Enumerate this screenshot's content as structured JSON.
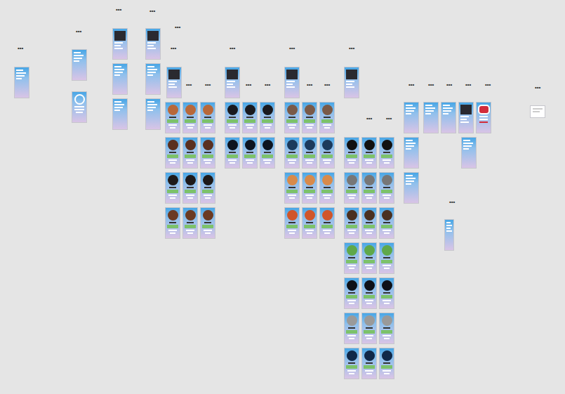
{
  "canvas": {
    "labels": [
      "•••",
      "•••",
      "•••",
      "•••",
      "•••",
      "•••",
      "•••",
      "•••",
      "•••",
      "•••",
      "•••",
      "•••",
      "•••",
      "•••",
      "•••",
      "•••",
      "•••",
      "•••",
      "•••",
      "•••",
      "•••",
      "•••",
      "•••",
      "•••"
    ],
    "groups": [
      {
        "frames": [
          {
            "kind": "plain"
          }
        ]
      },
      {
        "frames": [
          {
            "kind": "plain"
          },
          {
            "kind": "profile"
          }
        ]
      },
      {
        "frames": [
          {
            "kind": "photo"
          },
          {
            "kind": "plain"
          },
          {
            "kind": "plain"
          }
        ]
      },
      {
        "frames": [
          {
            "kind": "photo"
          },
          {
            "kind": "plain"
          },
          {
            "kind": "plain"
          }
        ]
      },
      {
        "frames": [
          {
            "kind": "photo"
          }
        ]
      },
      {
        "frames": [
          {
            "kind": "avatar",
            "color": "#b8683a"
          },
          {
            "kind": "avatar",
            "color": "#b8683a"
          },
          {
            "kind": "avatar",
            "color": "#b8683a"
          },
          {
            "kind": "avatar",
            "color": "#5a3020"
          },
          {
            "kind": "avatar",
            "color": "#5a3020"
          },
          {
            "kind": "avatar",
            "color": "#5a3020"
          },
          {
            "kind": "avatar",
            "color": "#1e1a1a"
          },
          {
            "kind": "avatar",
            "color": "#1e1a1a"
          },
          {
            "kind": "avatar",
            "color": "#1e1a1a"
          },
          {
            "kind": "avatar",
            "color": "#6b3a22"
          },
          {
            "kind": "avatar",
            "color": "#6b3a22"
          },
          {
            "kind": "avatar",
            "color": "#6b3a22"
          }
        ]
      },
      {
        "frames": [
          {
            "kind": "photo"
          }
        ]
      },
      {
        "frames": [
          {
            "kind": "avatar",
            "color": "#1a1a1f"
          },
          {
            "kind": "avatar",
            "color": "#1a1a1f"
          },
          {
            "kind": "avatar",
            "color": "#1a1a1f"
          },
          {
            "kind": "avatar",
            "color": "#0d1420"
          },
          {
            "kind": "avatar",
            "color": "#0d1420"
          },
          {
            "kind": "avatar",
            "color": "#0d1420"
          }
        ]
      },
      {
        "frames": [
          {
            "kind": "photo"
          }
        ]
      },
      {
        "frames": [
          {
            "kind": "avatar",
            "color": "#7a5a48"
          },
          {
            "kind": "avatar",
            "color": "#7a5a48"
          },
          {
            "kind": "avatar",
            "color": "#7a5a48"
          },
          {
            "kind": "avatar",
            "color": "#1c3a5c"
          },
          {
            "kind": "avatar",
            "color": "#1c3a5c"
          },
          {
            "kind": "avatar",
            "color": "#1c3a5c"
          },
          {
            "kind": "avatar",
            "color": "#d88a4a"
          },
          {
            "kind": "avatar",
            "color": "#d88a4a"
          },
          {
            "kind": "avatar",
            "color": "#d88a4a"
          },
          {
            "kind": "avatar",
            "color": "#d0552a"
          },
          {
            "kind": "avatar",
            "color": "#d0552a"
          },
          {
            "kind": "avatar",
            "color": "#d0552a"
          }
        ]
      },
      {
        "frames": [
          {
            "kind": "photo"
          }
        ]
      },
      {
        "frames": [
          {
            "kind": "avatar",
            "color": "#111111"
          },
          {
            "kind": "avatar",
            "color": "#111111"
          },
          {
            "kind": "avatar",
            "color": "#111111"
          },
          {
            "kind": "avatar",
            "color": "#777777"
          },
          {
            "kind": "avatar",
            "color": "#777777"
          },
          {
            "kind": "avatar",
            "color": "#777777"
          },
          {
            "kind": "avatar",
            "color": "#4a3020"
          },
          {
            "kind": "avatar",
            "color": "#4a3020"
          },
          {
            "kind": "avatar",
            "color": "#4a3020"
          },
          {
            "kind": "avatar",
            "color": "#5fa84a"
          },
          {
            "kind": "avatar",
            "color": "#5fa84a"
          },
          {
            "kind": "avatar",
            "color": "#5fa84a"
          },
          {
            "kind": "avatar",
            "color": "#0e1118"
          },
          {
            "kind": "avatar",
            "color": "#0e1118"
          },
          {
            "kind": "avatar",
            "color": "#0e1118"
          },
          {
            "kind": "avatar",
            "color": "#9a9a9a"
          },
          {
            "kind": "avatar",
            "color": "#9a9a9a"
          },
          {
            "kind": "avatar",
            "color": "#9a9a9a"
          },
          {
            "kind": "avatar",
            "color": "#102848"
          },
          {
            "kind": "avatar",
            "color": "#102848"
          },
          {
            "kind": "avatar",
            "color": "#102848"
          }
        ]
      },
      {
        "frames": [
          {
            "kind": "plain"
          },
          {
            "kind": "plain"
          },
          {
            "kind": "plain"
          }
        ]
      },
      {
        "frames": [
          {
            "kind": "plain"
          },
          {
            "kind": "plain"
          },
          {
            "kind": "photo"
          },
          {
            "kind": "heart"
          }
        ]
      },
      {
        "frames": [
          {
            "kind": "plain"
          }
        ]
      },
      {
        "frames": [
          {
            "kind": "narrow"
          }
        ]
      },
      {
        "frames": [
          {
            "kind": "card"
          }
        ]
      }
    ]
  }
}
